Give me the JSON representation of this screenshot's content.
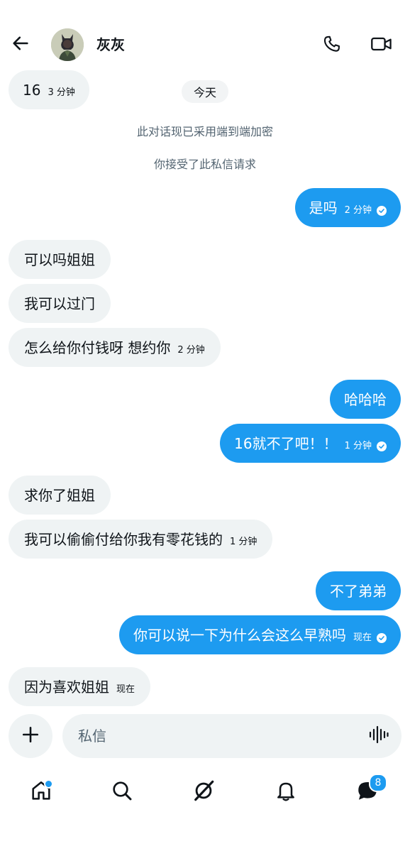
{
  "header": {
    "contact_name": "灰灰"
  },
  "thread": {
    "day_label": "今天",
    "system_notes": [
      "此对话现已采用端到端加密",
      "你接受了此私信请求"
    ],
    "messages": [
      {
        "dir": "in",
        "text": "16",
        "time": "3 分钟"
      },
      {
        "dir": "out",
        "text": "是吗",
        "time": "2 分钟",
        "read": true
      },
      {
        "dir": "in",
        "text": "可以吗姐姐",
        "time": ""
      },
      {
        "dir": "in",
        "text": "我可以过门",
        "time": ""
      },
      {
        "dir": "in",
        "text": "怎么给你付钱呀 想约你",
        "time": "2 分钟"
      },
      {
        "dir": "out",
        "text": "哈哈哈",
        "time": ""
      },
      {
        "dir": "out",
        "text": "16就不了吧！！",
        "time": "1 分钟",
        "read": true
      },
      {
        "dir": "in",
        "text": "求你了姐姐",
        "time": ""
      },
      {
        "dir": "in",
        "text": "我可以偷偷付给你我有零花钱的",
        "time": "1 分钟"
      },
      {
        "dir": "out",
        "text": "不了弟弟",
        "time": ""
      },
      {
        "dir": "out",
        "text": "你可以说一下为什么会这么早熟吗",
        "time": "现在",
        "read": true
      },
      {
        "dir": "in",
        "text": "因为喜欢姐姐",
        "time": "现在"
      }
    ]
  },
  "composer": {
    "placeholder": "私信"
  },
  "bottom_nav": {
    "messages_badge": "8"
  },
  "colors": {
    "accent": "#1d9bf0",
    "incoming_bubble": "#eff3f4",
    "text_primary": "#0f1419",
    "text_secondary": "#536471"
  },
  "icons": {
    "back": "arrow-left-icon",
    "call": "phone-icon",
    "video": "video-camera-icon",
    "add": "plus-icon",
    "voice": "voice-wave-icon",
    "home": "home-icon",
    "search": "search-icon",
    "grok": "grok-icon",
    "notifications": "bell-icon",
    "messages": "chat-bubble-icon",
    "read": "check-circle-icon"
  }
}
